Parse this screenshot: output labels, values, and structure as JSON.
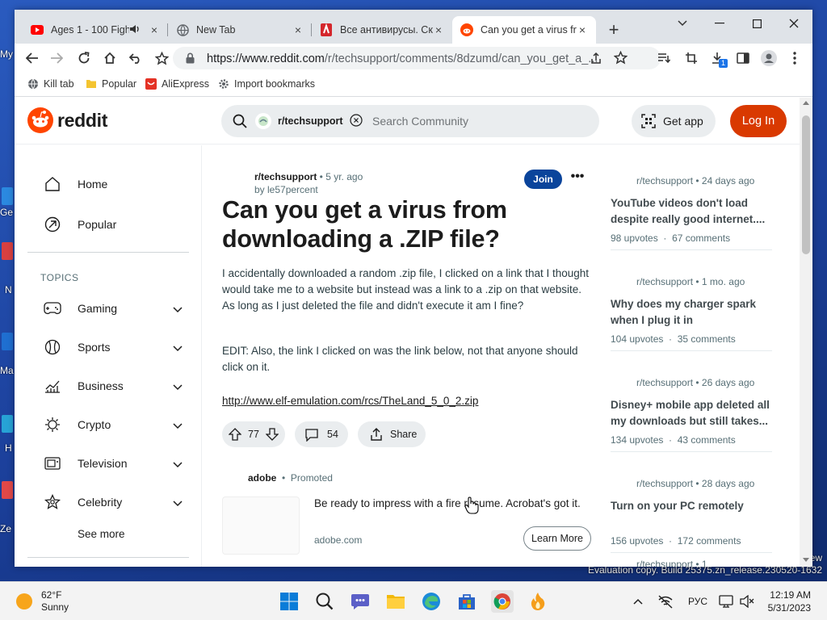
{
  "desktop": {
    "labels": [
      "My",
      "Ge",
      "N",
      "Ma",
      "H",
      "Ze"
    ],
    "watermark_line1": "ew",
    "watermark_line2": "Evaluation copy. Build 25375.zn_release.230520-1632"
  },
  "browser": {
    "tabs": [
      {
        "title": "Ages 1 - 100 Figh",
        "favicon": "youtube-icon",
        "close": "×"
      },
      {
        "title": "New Tab",
        "favicon": "chrome-globe-icon",
        "close": "×"
      },
      {
        "title": "Все антивирусы. Ск",
        "favicon": "antivirus-icon",
        "close": "×"
      },
      {
        "title": "Can you get a virus fr",
        "favicon": "reddit-icon",
        "close": "×"
      }
    ],
    "new_tab": "+",
    "url_host": "https://www.reddit.com",
    "url_path": "/r/techsupport/comments/8dzumd/can_you_get_a_...",
    "bookmarks": [
      {
        "label": "Kill tab",
        "icon": "globe-icon"
      },
      {
        "label": "Popular",
        "icon": "folder-icon"
      },
      {
        "label": "AliExpress",
        "icon": "aliexpress-icon"
      },
      {
        "label": "Import bookmarks",
        "icon": "gear-icon"
      }
    ],
    "download_badge": "1"
  },
  "reddit": {
    "logo_text": "reddit",
    "search_chip": "r/techsupport",
    "search_placeholder": "Search Community",
    "get_app": "Get app",
    "log_in": "Log In",
    "nav": {
      "home": "Home",
      "popular": "Popular",
      "topics_label": "TOPICS",
      "topics": [
        "Gaming",
        "Sports",
        "Business",
        "Crypto",
        "Television",
        "Celebrity"
      ],
      "see_more": "See more"
    },
    "post": {
      "subreddit": "r/techsupport",
      "age": "5 yr. ago",
      "author": "by le57percent",
      "join": "Join",
      "more": "•••",
      "title": "Can you get a virus from downloading a .ZIP file?",
      "body1": "I accidentally downloaded a random .zip file, I clicked on a link that I thought would take me to a website but instead was a link to a .zip on that website. As long as I just deleted the file and didn't execute it am I fine?",
      "body2": "EDIT: Also, the link I clicked on was the link below, not that anyone should click on it.",
      "link": "http://www.elf-emulation.com/rcs/TheLand_5_0_2.zip",
      "votes": "77",
      "comments": "54",
      "share": "Share"
    },
    "promo": {
      "advertiser": "adobe",
      "promoted": "Promoted",
      "text": "Be ready to impress with a fire resume. Acrobat's got it.",
      "domain": "adobe.com",
      "cta": "Learn More"
    },
    "related": [
      {
        "sub": "r/techsupport",
        "age": "24 days ago",
        "title": "YouTube videos don't load despite really good internet....",
        "upvotes": "98 upvotes",
        "comments": "67 comments"
      },
      {
        "sub": "r/techsupport",
        "age": "1 mo. ago",
        "title": "Why does my charger spark when I plug it in",
        "upvotes": "104 upvotes",
        "comments": "35 comments"
      },
      {
        "sub": "r/techsupport",
        "age": "26 days ago",
        "title": "Disney+ mobile app deleted all my downloads but still takes...",
        "upvotes": "134 upvotes",
        "comments": "43 comments"
      },
      {
        "sub": "r/techsupport",
        "age": "28 days ago",
        "title": "Turn on your PC remotely",
        "upvotes": "156 upvotes",
        "comments": "172 comments"
      }
    ],
    "related_partial": "r/techsupport • 1",
    "colors": {
      "accent": "#ff4500",
      "login": "#d93900",
      "join": "#0a449b"
    }
  },
  "taskbar": {
    "temperature": "62°F",
    "condition": "Sunny",
    "language": "РУС",
    "time": "12:19 AM",
    "date": "5/31/2023"
  }
}
